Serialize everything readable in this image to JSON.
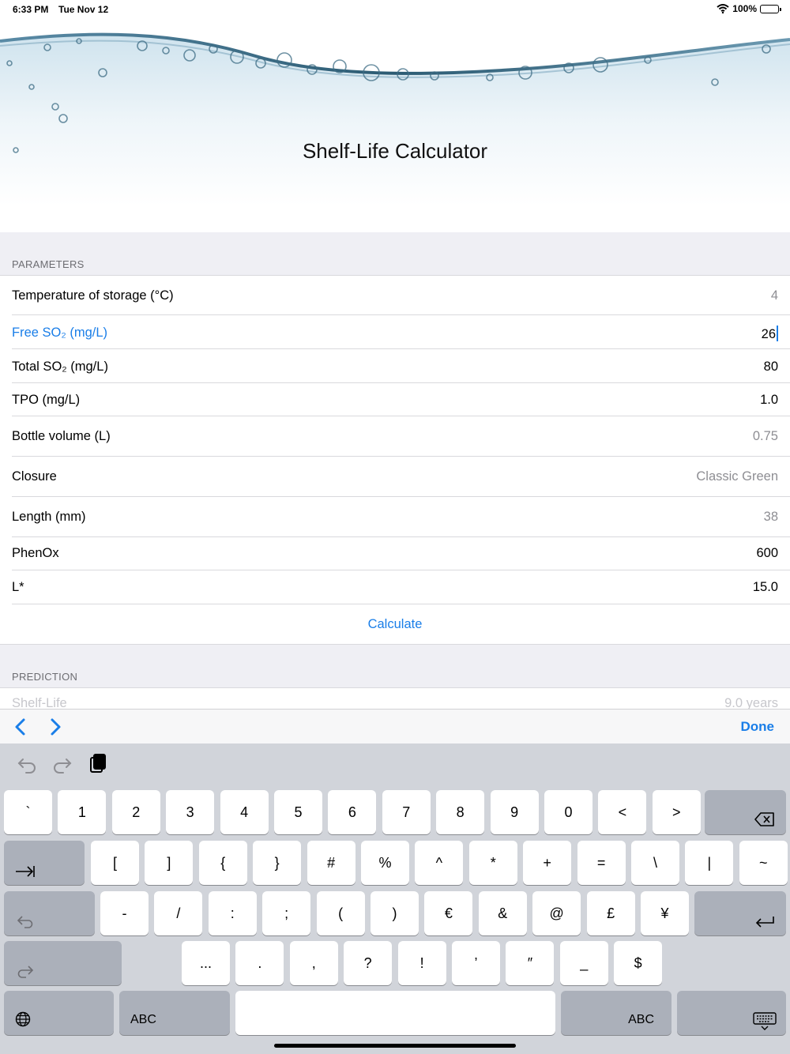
{
  "status": {
    "time": "6:33 PM",
    "date": "Tue Nov 12",
    "battery": "100%"
  },
  "header": {
    "title": "Shelf-Life Calculator"
  },
  "parameters": {
    "section_label": "PARAMETERS",
    "rows": [
      {
        "label": "Temperature of storage (°C)",
        "value": "4"
      },
      {
        "label": "Free SO₂ (mg/L)",
        "value": "26"
      },
      {
        "label": "Total SO₂ (mg/L)",
        "value": "80"
      },
      {
        "label": "TPO (mg/L)",
        "value": "1.0"
      },
      {
        "label": "Bottle volume (L)",
        "value": "0.75"
      },
      {
        "label": "Closure",
        "value": "Classic Green"
      },
      {
        "label": "Length (mm)",
        "value": "38"
      },
      {
        "label": "PhenOx",
        "value": "600"
      },
      {
        "label": "L*",
        "value": "15.0"
      }
    ],
    "calculate_label": "Calculate"
  },
  "prediction": {
    "section_label": "PREDICTION",
    "label": "Shelf-Life",
    "value": "9.0 years"
  },
  "accessory": {
    "done_label": "Done"
  },
  "keyboard": {
    "row1": [
      "`",
      "1",
      "2",
      "3",
      "4",
      "5",
      "6",
      "7",
      "8",
      "9",
      "0",
      "<",
      ">"
    ],
    "row2": [
      "[",
      "]",
      "{",
      "}",
      "#",
      "%",
      "^",
      "*",
      "+",
      "=",
      "\\",
      "|",
      "~"
    ],
    "row3": [
      "-",
      "/",
      ":",
      ";",
      "(",
      ")",
      "€",
      "&",
      "@",
      "£",
      "¥"
    ],
    "row4": [
      "...",
      ".",
      ",",
      "?",
      "!",
      "’",
      "″",
      "_",
      "$"
    ],
    "abc_left": "ABC",
    "abc_right": "ABC"
  },
  "colors": {
    "accent": "#1a7ee8",
    "group_background": "#efeff4",
    "keyboard_background": "#d1d4da"
  }
}
